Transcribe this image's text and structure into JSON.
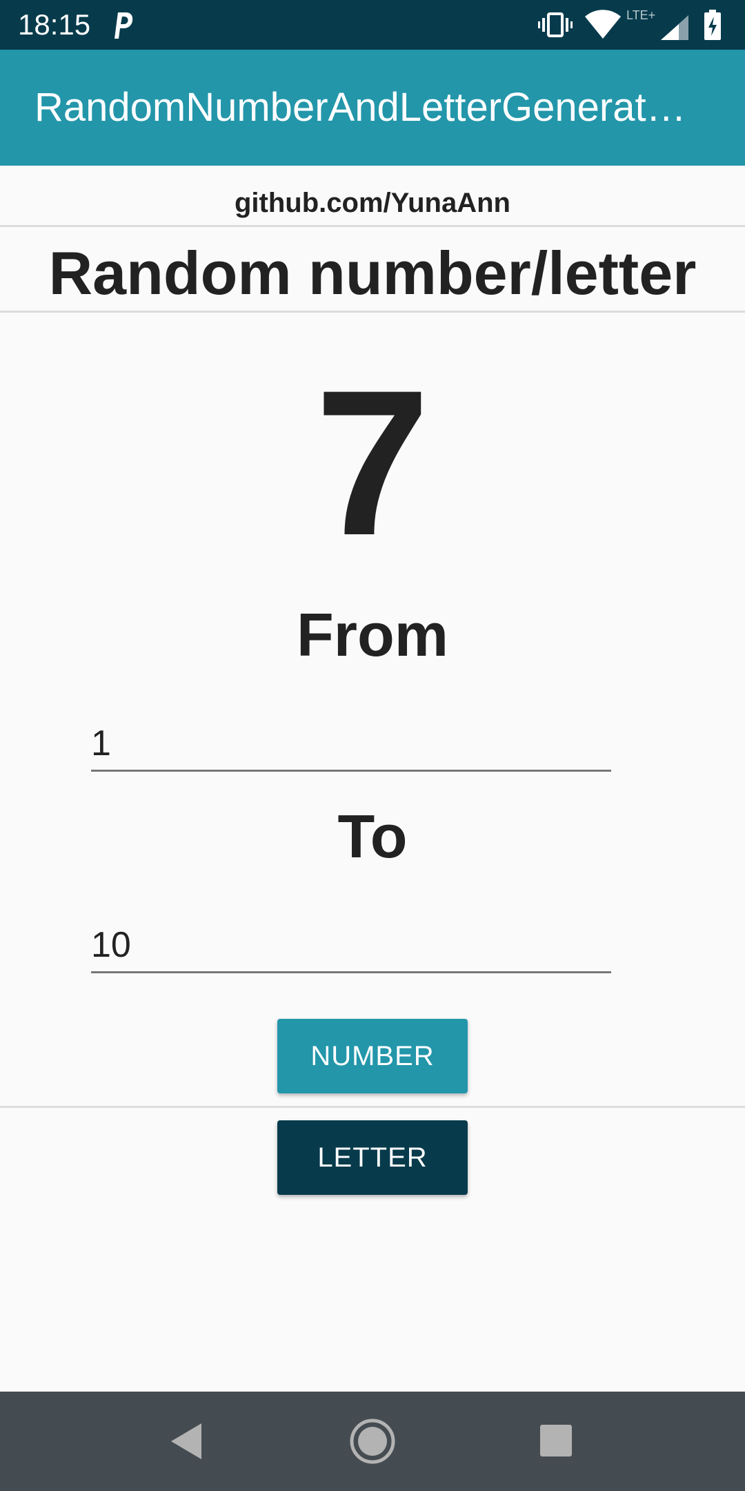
{
  "status_bar": {
    "time": "18:15",
    "network_label": "LTE+",
    "icons": [
      "parking-app-icon",
      "vibrate-icon",
      "wifi-icon",
      "signal-icon",
      "battery-charging-icon"
    ]
  },
  "app_bar": {
    "title": "RandomNumberAndLetterGenerat…"
  },
  "content": {
    "credit": "github.com/YunaAnn",
    "heading": "Random number/letter",
    "result": "7",
    "from_label": "From",
    "from_value": "1",
    "to_label": "To",
    "to_value": "10",
    "number_button": "NUMBER",
    "letter_button": "LETTER"
  },
  "nav_bar": {
    "icons": [
      "back-icon",
      "home-icon",
      "recents-icon"
    ]
  },
  "colors": {
    "status_bar": "#073b4c",
    "app_bar": "#2396aa",
    "number_button": "#2396aa",
    "letter_button": "#073b4c",
    "nav_bar": "#454c51"
  }
}
